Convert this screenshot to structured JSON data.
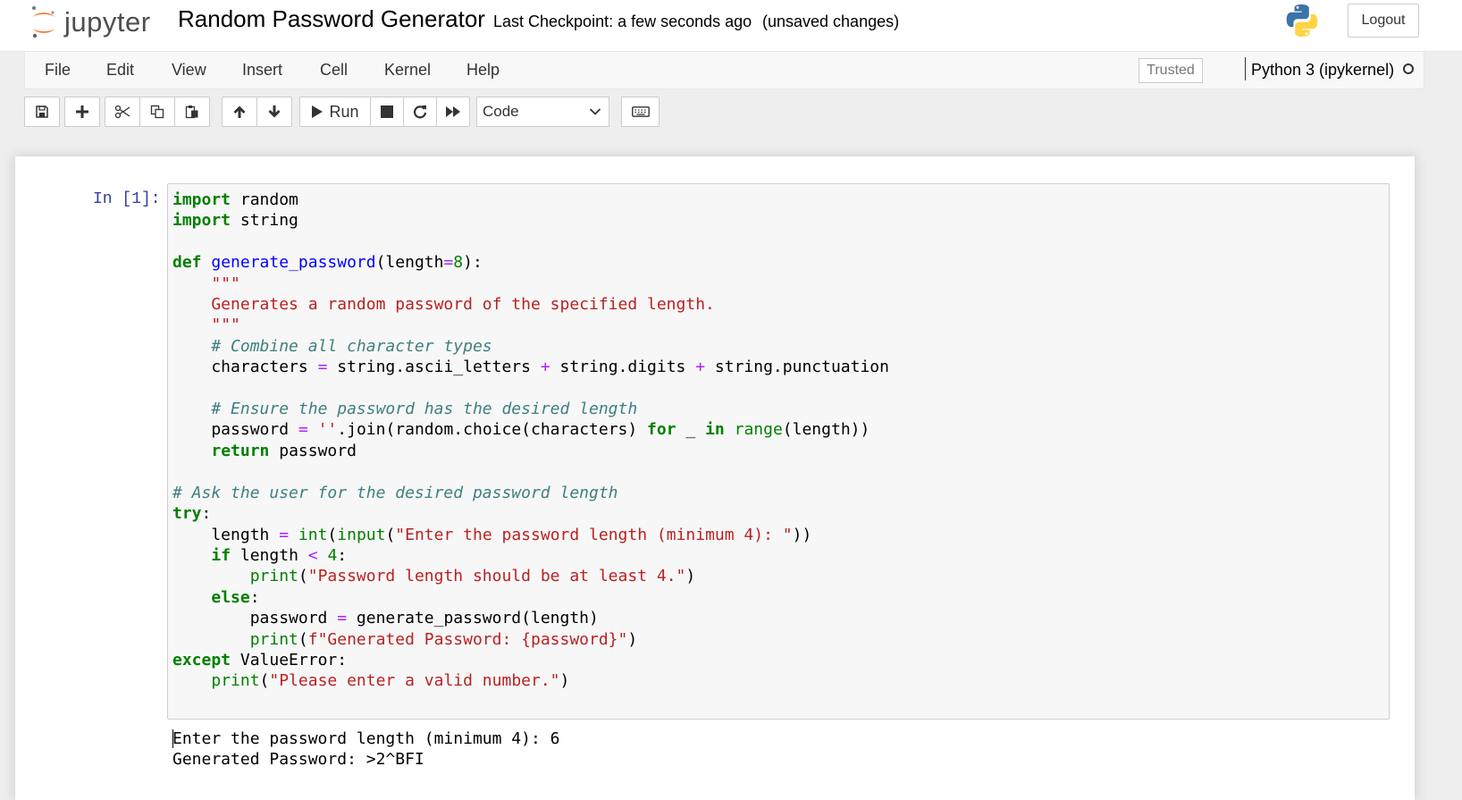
{
  "header": {
    "logo_text": "jupyter",
    "notebook_name": "Random Password Generator",
    "checkpoint": "Last Checkpoint: a few seconds ago",
    "autosave_status": "(unsaved changes)",
    "logout_label": "Logout"
  },
  "menubar": {
    "items": [
      "File",
      "Edit",
      "View",
      "Insert",
      "Cell",
      "Kernel",
      "Help"
    ],
    "trusted_label": "Trusted",
    "kernel_name": "Python 3 (ipykernel)"
  },
  "toolbar": {
    "buttons": [
      "save-icon",
      "plus-icon",
      "scissors-icon",
      "copy-icon",
      "paste-icon",
      "arrow-up-icon",
      "arrow-down-icon",
      "play-icon",
      "stop-icon",
      "restart-icon",
      "fast-forward-icon",
      "keyboard-icon"
    ],
    "run_label": "Run",
    "cell_type": "Code"
  },
  "cell": {
    "prompt": "In [1]:",
    "lines": [
      "import random",
      "import string",
      "",
      "def generate_password(length=8):",
      "    \"\"\"",
      "    Generates a random password of the specified length.",
      "    \"\"\"",
      "    # Combine all character types",
      "    characters = string.ascii_letters + string.digits + string.punctuation",
      "",
      "    # Ensure the password has the desired length",
      "    password = ''.join(random.choice(characters) for _ in range(length))",
      "    return password",
      "",
      "# Ask the user for the desired password length",
      "try:",
      "    length = int(input(\"Enter the password length (minimum 4): \"))",
      "    if length < 4:",
      "        print(\"Password length should be at least 4.\")",
      "    else:",
      "        password = generate_password(length)",
      "        print(f\"Generated Password: {password}\")",
      "except ValueError:",
      "    print(\"Please enter a valid number.\")"
    ],
    "output_lines": [
      "Enter the password length (minimum 4): 6",
      "Generated Password: >2^BFI"
    ]
  },
  "colors": {
    "keyword": "#008000",
    "function_name": "#0000ff",
    "string": "#ba2121",
    "comment": "#408080",
    "operator": "#aa22ff",
    "prompt": "#303f9f",
    "logo_orange": "#f37726"
  }
}
